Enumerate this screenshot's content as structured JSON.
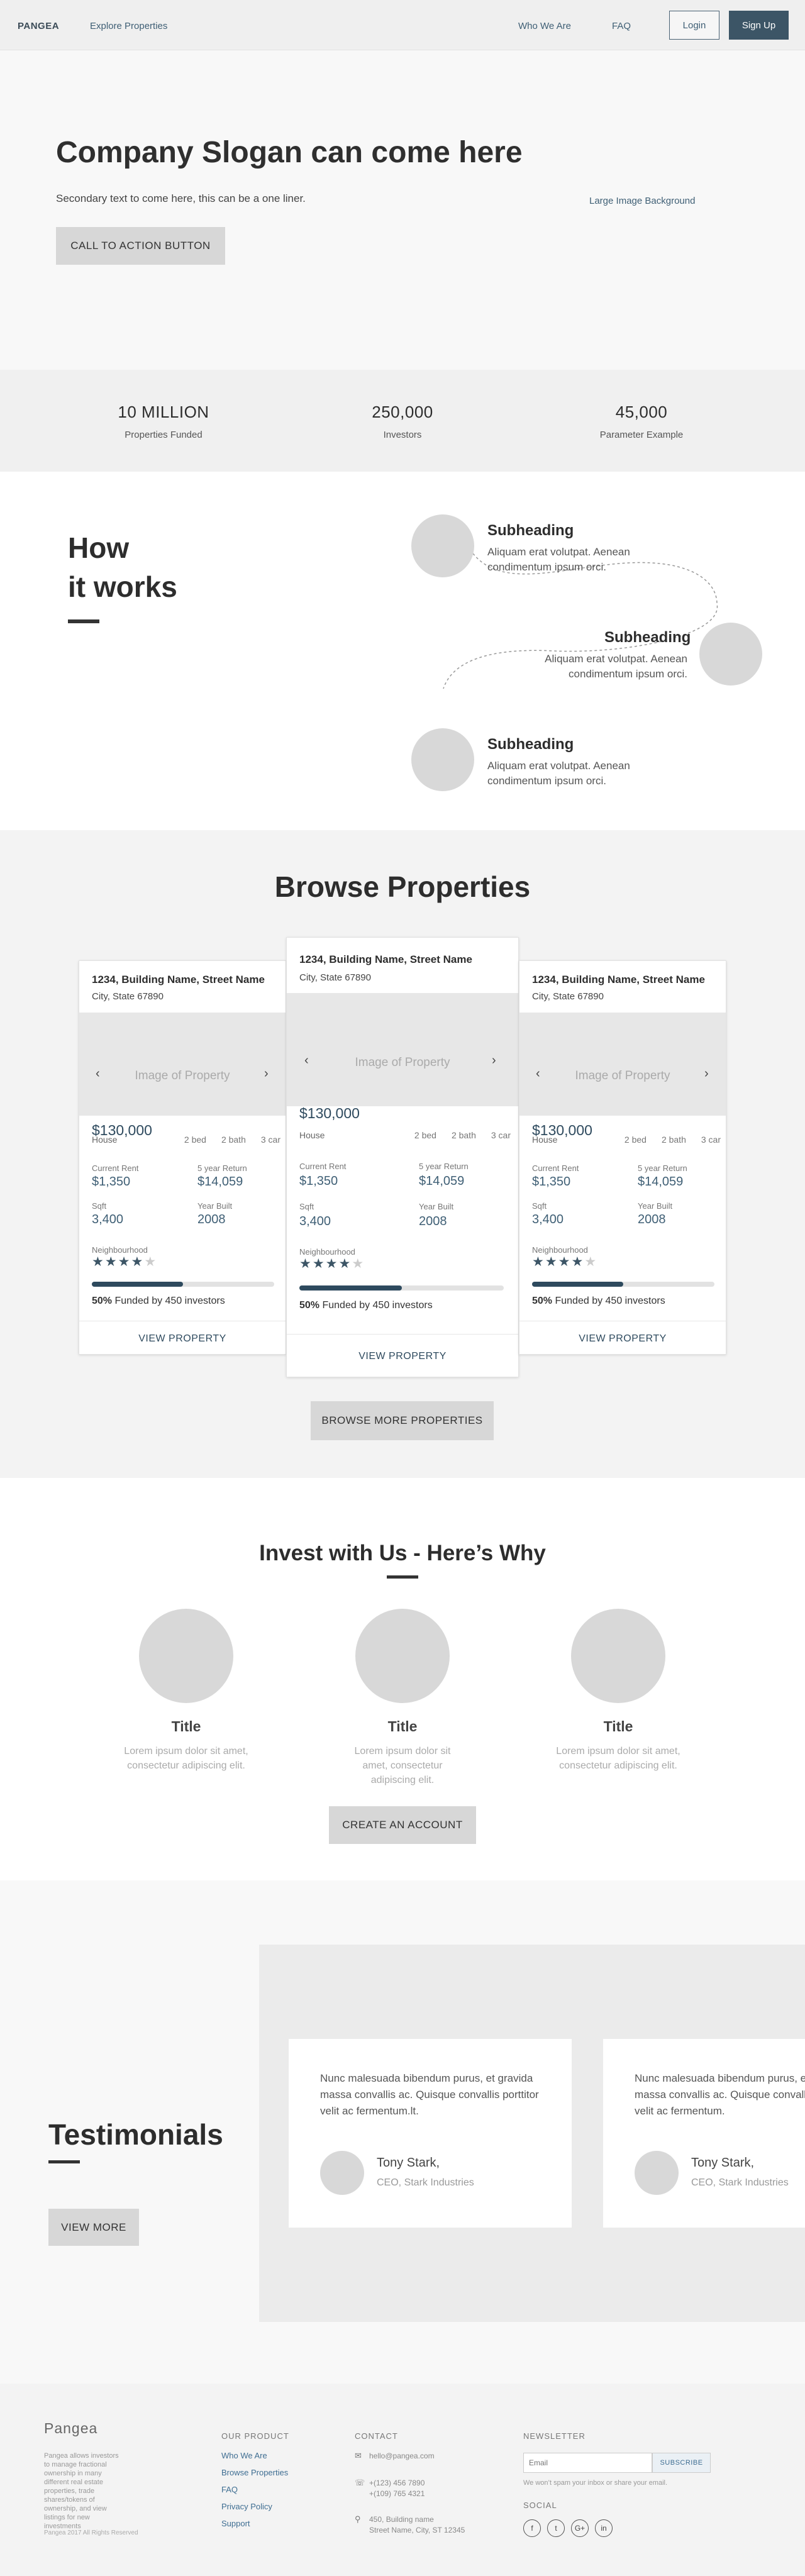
{
  "nav": {
    "logo": "PANGEA",
    "explore": "Explore Properties",
    "who": "Who We Are",
    "faq": "FAQ",
    "login": "Login",
    "signup": "Sign Up"
  },
  "hero": {
    "title": "Company Slogan can come here",
    "subtitle": "Secondary text to come here, this can be a one liner.",
    "cta": "CALL TO ACTION BUTTON",
    "bg_label": "Large Image Background"
  },
  "stats": [
    {
      "value": "10 MILLION",
      "label": "Properties Funded"
    },
    {
      "value": "250,000",
      "label": "Investors"
    },
    {
      "value": "45,000",
      "label": "Parameter Example"
    }
  ],
  "how": {
    "title_line1": "How",
    "title_line2": "it works",
    "steps": [
      {
        "heading": "Subheading",
        "text": "Aliquam erat volutpat. Aenean condimentum ipsum orci."
      },
      {
        "heading": "Subheading",
        "text": "Aliquam erat volutpat. Aenean condimentum ipsum orci."
      },
      {
        "heading": "Subheading",
        "text": "Aliquam erat volutpat. Aenean condimentum ipsum orci."
      }
    ]
  },
  "browse": {
    "title": "Browse Properties",
    "more": "BROWSE MORE PROPERTIES",
    "cards": [
      {
        "address": "1234, Building Name, Street Name",
        "city": "City, State 67890",
        "image_label": "Image of Property",
        "price": "$130,000",
        "type": "House",
        "bed": "2 bed",
        "bath": "2 bath",
        "car": "3 car",
        "rent_label": "Current Rent",
        "rent": "$1,350",
        "return_label": "5 year Return",
        "return": "$14,059",
        "sqft_label": "Sqft",
        "sqft": "3,400",
        "year_label": "Year Built",
        "year": "2008",
        "neigh_label": "Neighbourhood",
        "rating": 4,
        "funded_pct": 0.5,
        "funded_bold": "50%",
        "funded_text": " Funded by 450 investors",
        "view": "VIEW PROPERTY"
      },
      {
        "address": "1234, Building Name, Street Name",
        "city": "City, State 67890",
        "image_label": "Image of Property",
        "price": "$130,000",
        "type": "House",
        "bed": "2 bed",
        "bath": "2 bath",
        "car": "3 car",
        "rent_label": "Current Rent",
        "rent": "$1,350",
        "return_label": "5 year Return",
        "return": "$14,059",
        "sqft_label": "Sqft",
        "sqft": "3,400",
        "year_label": "Year Built",
        "year": "2008",
        "neigh_label": "Neighbourhood",
        "rating": 4,
        "funded_pct": 0.5,
        "funded_bold": "50%",
        "funded_text": " Funded by 450 investors",
        "view": "VIEW PROPERTY"
      },
      {
        "address": "1234, Building Name, Street Name",
        "city": "City, State 67890",
        "image_label": "Image of Property",
        "price": "$130,000",
        "type": "House",
        "bed": "2 bed",
        "bath": "2 bath",
        "car": "3 car",
        "rent_label": "Current Rent",
        "rent": "$1,350",
        "return_label": "5 year Return",
        "return": "$14,059",
        "sqft_label": "Sqft",
        "sqft": "3,400",
        "year_label": "Year Built",
        "year": "2008",
        "neigh_label": "Neighbourhood",
        "rating": 4,
        "funded_pct": 0.5,
        "funded_bold": "50%",
        "funded_text": " Funded by 450 investors",
        "view": "VIEW PROPERTY"
      }
    ]
  },
  "invest": {
    "title": "Invest with Us - Here’s Why",
    "features": [
      {
        "title": "Title",
        "text": "Lorem ipsum dolor sit amet, consectetur adipiscing elit."
      },
      {
        "title": "Title",
        "text": "Lorem ipsum dolor sit amet, consectetur adipiscing elit."
      },
      {
        "title": "Title",
        "text": "Lorem ipsum dolor sit amet, consectetur adipiscing elit."
      }
    ],
    "create": "CREATE AN ACCOUNT"
  },
  "testimonials": {
    "title": "Testimonials",
    "view_more": "VIEW MORE",
    "items": [
      {
        "quote": "Nunc malesuada bibendum purus, et gravida massa convallis ac. Quisque convallis porttitor velit ac fermentum.lt.",
        "name": "Tony Stark,",
        "role": "CEO, Stark Industries"
      },
      {
        "quote": "Nunc malesuada bibendum purus, et gravida massa convallis ac. Quisque convallis porttitor velit ac fermentum.",
        "name": "Tony Stark,",
        "role": "CEO, Stark Industries"
      }
    ]
  },
  "footer": {
    "logo": "Pangea",
    "desc": "Pangea allows investors to manage fractional ownership in many different real estate properties, trade shares/tokens of ownership, and view listings for new investments",
    "copyright": "Pangea 2017 All Rights Reserved",
    "product_head": "OUR PRODUCT",
    "product_links": [
      "Who We Are",
      "Browse Properties",
      "FAQ",
      "Privacy Policy",
      "Support"
    ],
    "contact_head": "CONTACT",
    "email": "hello@pangea.com",
    "phone1": "+(123) 456 7890",
    "phone2": "+(109) 765 4321",
    "address1": "450, Building name",
    "address2": "Street Name, City, ST 12345",
    "newsletter_head": "NEWSLETTER",
    "email_placeholder": "Email",
    "subscribe": "SUBSCRIBE",
    "nl_note": "We won’t spam your inbox or share your email.",
    "social_head": "SOCIAL",
    "social": [
      "f",
      "t",
      "G+",
      "in"
    ]
  }
}
